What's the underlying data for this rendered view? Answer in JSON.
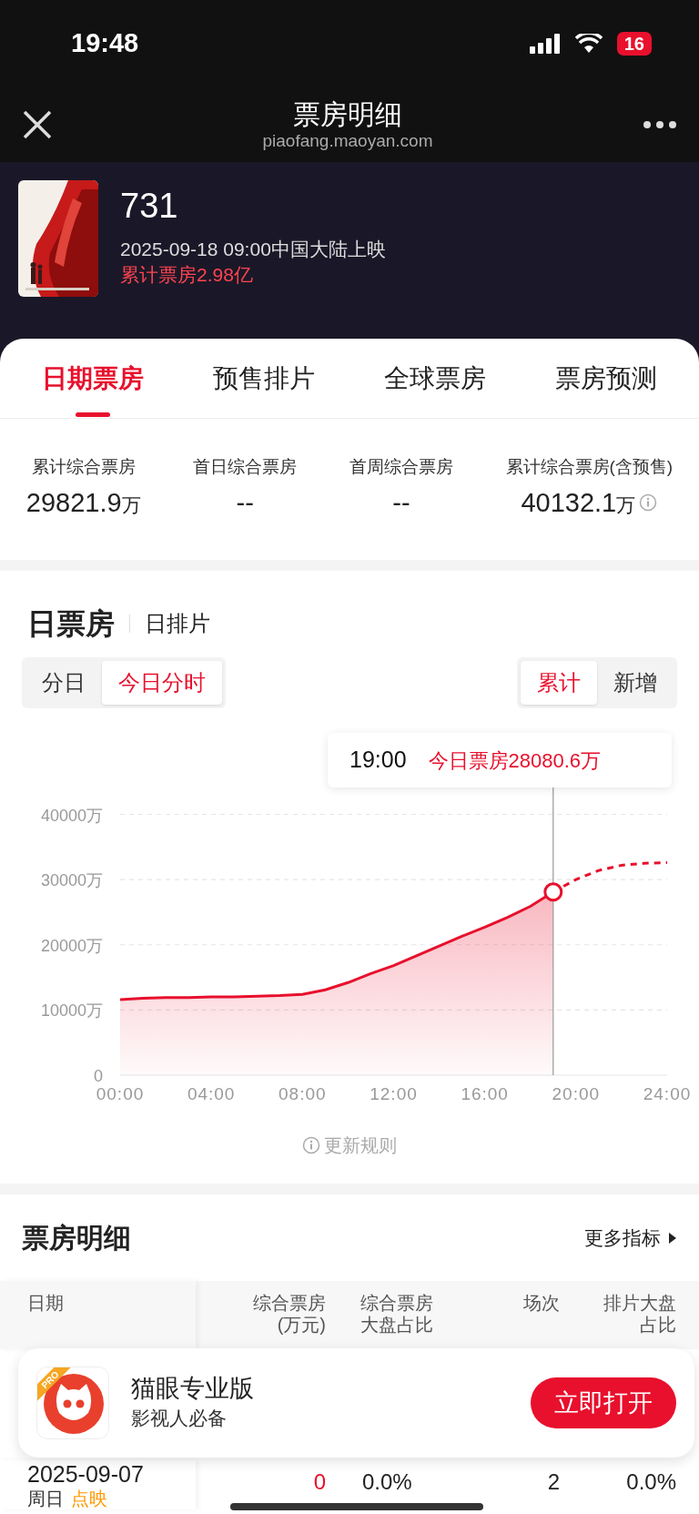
{
  "status_bar": {
    "time": "19:48",
    "battery": "16"
  },
  "nav": {
    "title": "票房明细",
    "url": "piaofang.maoyan.com"
  },
  "movie": {
    "title": "731",
    "release": "2025-09-18 09:00中国大陆上映",
    "total": "累计票房2.98亿"
  },
  "tabs": [
    {
      "label": "日期票房",
      "selected": true
    },
    {
      "label": "预售排片",
      "selected": false
    },
    {
      "label": "全球票房",
      "selected": false
    },
    {
      "label": "票房预测",
      "selected": false
    }
  ],
  "stats": [
    {
      "label": "累计综合票房",
      "value": "29821.9",
      "unit": "万",
      "info": false
    },
    {
      "label": "首日综合票房",
      "value": "--",
      "info": false
    },
    {
      "label": "首周综合票房",
      "value": "--",
      "info": false
    },
    {
      "label": "累计综合票房(含预售)",
      "value": "40132.1",
      "unit": "万",
      "info": true
    }
  ],
  "daily": {
    "headings": [
      {
        "label": "日票房",
        "selected": true
      },
      {
        "label": "日排片",
        "selected": false
      }
    ],
    "range_toggle": [
      {
        "label": "分日",
        "selected": false
      },
      {
        "label": "今日分时",
        "selected": true
      }
    ],
    "mode_toggle": [
      {
        "label": "累计",
        "selected": true
      },
      {
        "label": "新增",
        "selected": false
      }
    ],
    "tooltip": {
      "time": "19:00",
      "label": "今日票房28080.6万"
    },
    "chart_data": {
      "type": "area",
      "x": [
        0,
        1,
        2,
        3,
        4,
        5,
        6,
        7,
        8,
        9,
        10,
        11,
        12,
        13,
        14,
        15,
        16,
        17,
        18,
        19,
        20,
        21,
        22,
        23,
        24
      ],
      "series": [
        {
          "type": "area",
          "color": "#e8102d",
          "values": [
            11600,
            11800,
            11900,
            11900,
            12000,
            12000,
            12100,
            12200,
            12400,
            13100,
            14200,
            15600,
            16800,
            18300,
            19800,
            21300,
            22700,
            24200,
            25900,
            28100,
            null,
            null,
            null,
            null,
            null
          ]
        },
        {
          "type": "line",
          "line_style": "dashed",
          "color": "#e8102d",
          "values": [
            null,
            null,
            null,
            null,
            null,
            null,
            null,
            null,
            null,
            null,
            null,
            null,
            null,
            null,
            null,
            null,
            null,
            null,
            null,
            28100,
            30000,
            31400,
            32200,
            32500,
            32600
          ]
        }
      ],
      "xlim": [
        0,
        24
      ],
      "ylim": [
        0,
        40000
      ],
      "xticks": [
        {
          "value": 0,
          "label": "00:00"
        },
        {
          "value": 4,
          "label": "04:00"
        },
        {
          "value": 8,
          "label": "08:00"
        },
        {
          "value": 12,
          "label": "12:00"
        },
        {
          "value": 16,
          "label": "16:00"
        },
        {
          "value": 20,
          "label": "20:00"
        },
        {
          "value": 24,
          "label": "24:00"
        }
      ],
      "yticks": [
        {
          "value": 0,
          "label": "0"
        },
        {
          "value": 10000,
          "label": "10000万"
        },
        {
          "value": 20000,
          "label": "20000万"
        },
        {
          "value": 30000,
          "label": "30000万"
        },
        {
          "value": 40000,
          "label": "40000万"
        }
      ],
      "grid": true,
      "ref_lines": [
        {
          "axis": "x",
          "value": 19
        }
      ]
    },
    "rules_link": "更新规则"
  },
  "detail": {
    "title": "票房明细",
    "more": "更多指标",
    "columns": [
      "日期",
      "综合票房(万元)",
      "综合票房大盘占比",
      "场次",
      "排片大盘占比"
    ],
    "rows": [
      {
        "date": "2025-09-07",
        "weekday": "周日",
        "tag": "点映",
        "box_office": "0",
        "share": "0.0%",
        "shows": "2",
        "show_share": "0.0%"
      }
    ]
  },
  "app_banner": {
    "badge": "PRO",
    "name": "猫眼专业版",
    "slogan": "影视人必备",
    "button": "立即打开"
  }
}
